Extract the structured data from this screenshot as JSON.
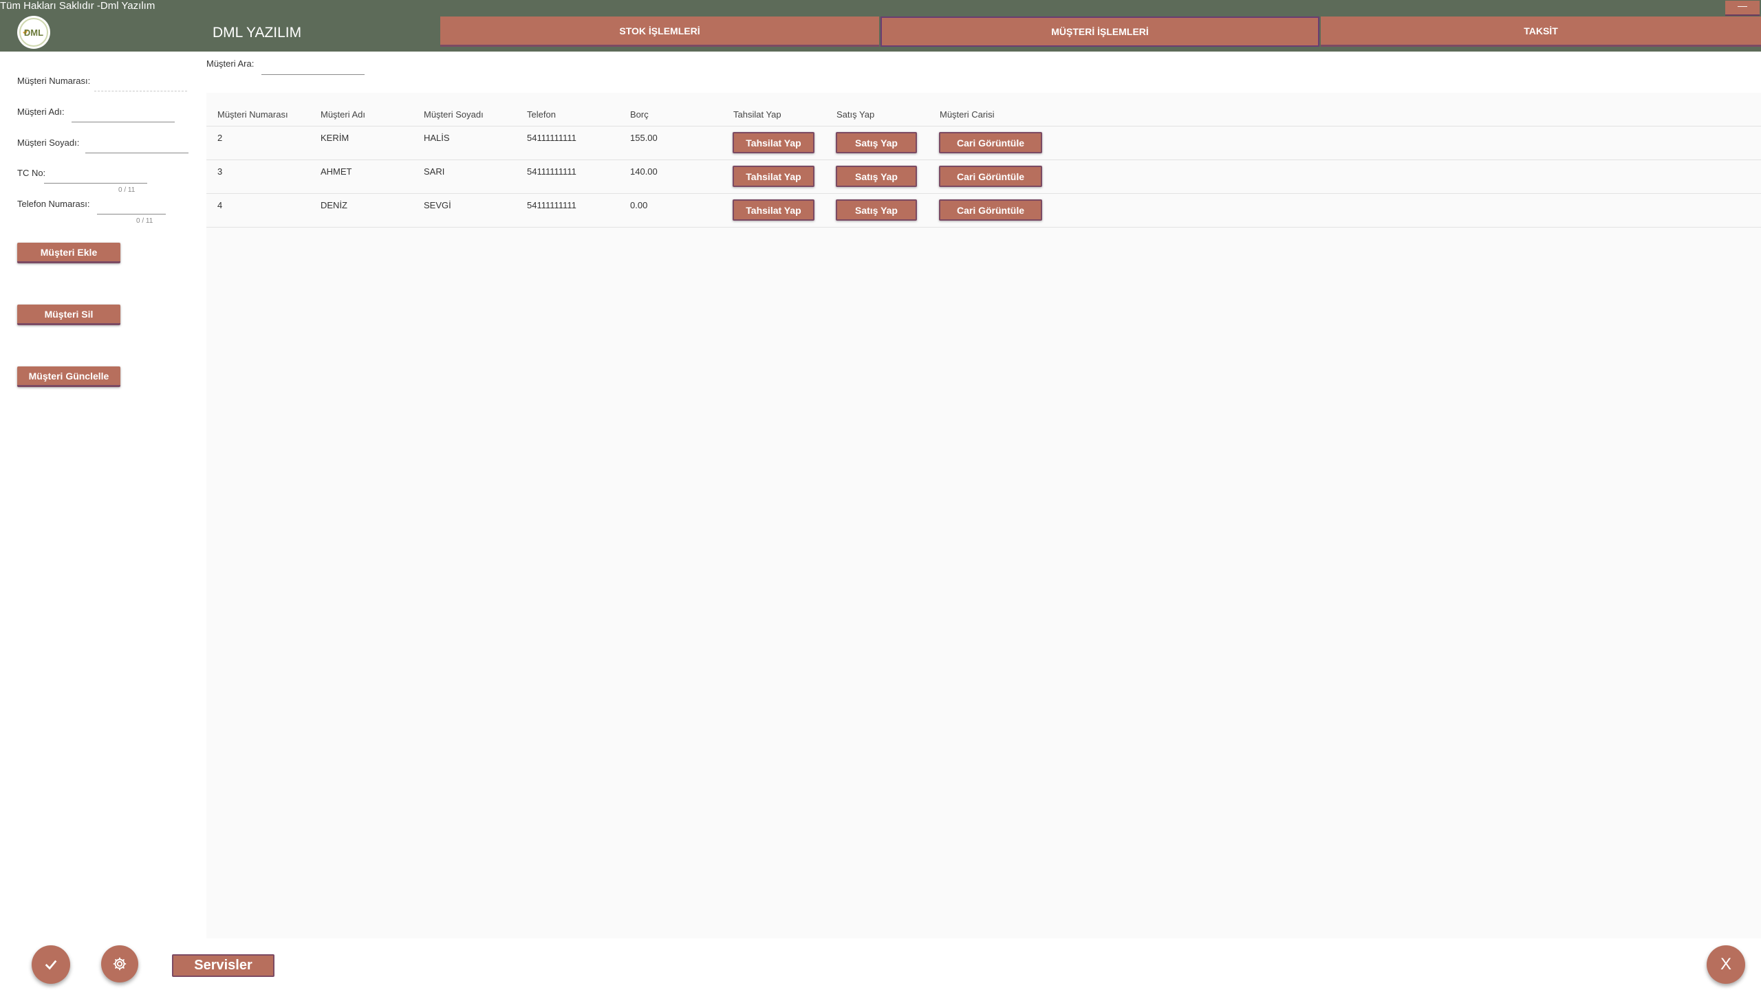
{
  "window": {
    "copyright": "Tüm Hakları Saklıdır -Dml Yazılım",
    "minimize_label": "—"
  },
  "header": {
    "logo_text": "DML",
    "app_title": "DML YAZILIM",
    "tabs": [
      {
        "label": "STOK İŞLEMLERİ",
        "active": false
      },
      {
        "label": "MÜŞTERİ İŞLEMLERİ",
        "active": true
      },
      {
        "label": "TAKSİT",
        "active": false
      }
    ]
  },
  "form": {
    "customer_number_label": "Müşteri Numarası:",
    "customer_name_label": "Müşteri Adı:",
    "customer_surname_label": "Müşteri Soyadı:",
    "tc_label": "TC No:",
    "tc_counter": "0 / 11",
    "phone_label": "Telefon Numarası:",
    "phone_counter": "0 / 11",
    "add_button": "Müşteri Ekle",
    "delete_button": "Müşteri Sil",
    "update_button": "Müşteri Günclelle"
  },
  "search": {
    "label": "Müşteri Ara:",
    "value": ""
  },
  "table": {
    "headers": [
      "Müşteri Numarası",
      "Müşteri Adı",
      "Müşteri Soyadı",
      "Telefon",
      "Borç",
      "Tahsilat Yap",
      "Satış Yap",
      "Müşteri Carisi"
    ],
    "button_labels": {
      "collect": "Tahsilat Yap",
      "sell": "Satış Yap",
      "account": "Cari Görüntüle"
    },
    "rows": [
      {
        "id": "2",
        "name": "KERİM",
        "surname": "HALİS",
        "phone": "54111111111",
        "debt": "155.00"
      },
      {
        "id": "3",
        "name": "AHMET",
        "surname": "SARI",
        "phone": "54111111111",
        "debt": "140.00"
      },
      {
        "id": "4",
        "name": "DENİZ",
        "surname": "SEVGİ",
        "phone": "54111111111",
        "debt": "0.00"
      }
    ]
  },
  "footer": {
    "services_label": "Servisler",
    "close_label": "X"
  },
  "icons": {
    "confirm": "check-icon",
    "settings": "gear-icon"
  },
  "colors": {
    "header_bg": "#5d6b59",
    "accent": "#b76f5d",
    "accent_border": "#7b4a63"
  }
}
